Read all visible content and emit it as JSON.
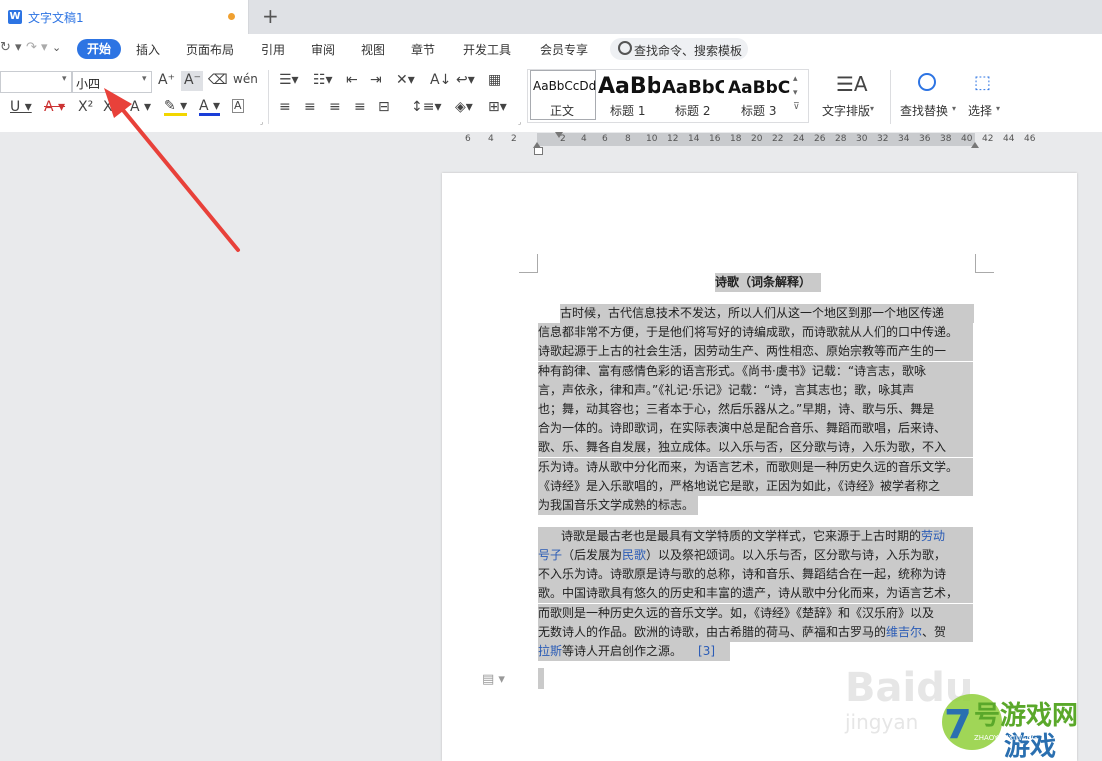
{
  "tab": {
    "title": "文字文稿1",
    "new_tab": "+"
  },
  "menu": {
    "items": [
      "开始",
      "插入",
      "页面布局",
      "引用",
      "审阅",
      "视图",
      "章节",
      "开发工具",
      "会员专享"
    ],
    "search_placeholder": "查找命令、搜索模板"
  },
  "ribbon": {
    "font_size": "小四",
    "styles": [
      {
        "sample": "AaBbCcDd",
        "label": "正文"
      },
      {
        "sample": "AaBb",
        "label": "标题 1"
      },
      {
        "sample": "AaBbC",
        "label": "标题 2"
      },
      {
        "sample": "AaBbC",
        "label": "标题 3"
      }
    ],
    "text_layout": "文字排版",
    "find_replace": "查找替换",
    "select": "选择"
  },
  "ruler": {
    "numbers": [
      "6",
      "4",
      "2",
      "2",
      "4",
      "6",
      "8",
      "10",
      "12",
      "14",
      "16",
      "18",
      "20",
      "22",
      "24",
      "26",
      "28",
      "30",
      "32",
      "34",
      "36",
      "38",
      "40",
      "42",
      "44",
      "46"
    ]
  },
  "document": {
    "title": "诗歌（词条解释）",
    "para1": [
      "古时候，古代信息技术不发达，所以人们从这一个地区到那一个地区传递",
      "信息都非常不方便，于是他们将写好的诗编成歌，而诗歌就从人们的口中传递。",
      "诗歌起源于上古的社会生活，因劳动生产、两性相恋、原始宗教等而产生的一",
      "种有韵律、富有感情色彩的语言形式。《尚书·虞书》记载：“诗言志，歌咏",
      "言，声依永，律和声。”《礼记·乐记》记载：“诗，言其志也；歌，咏其声",
      "也；舞，动其容也；三者本于心，然后乐器从之。”早期，诗、歌与乐、舞是",
      "合为一体的。诗即歌词，在实际表演中总是配合音乐、舞蹈而歌唱，后来诗、",
      "歌、乐、舞各自发展，独立成体。以入乐与否，区分歌与诗，入乐为歌，不入",
      "乐为诗。诗从歌中分化而来，为语言艺术，而歌则是一种历史久远的音乐文学。",
      "《诗经》是入乐歌唱的，严格地说它是歌，正因为如此，《诗经》被学者称之",
      "为我国音乐文学成熟的标志。"
    ],
    "para2_l1a": "诗歌是最古老也是最具有文学特质的文学样式，它来源于上古时期的",
    "para2_l1b": "劳动",
    "para2_l2a": "号子",
    "para2_l2b": "（后发展为",
    "para2_l2c": "民歌",
    "para2_l2d": "）以及祭祀颂词。以入乐与否，区分歌与诗，入乐为歌，",
    "para2_rest": [
      "不入乐为诗。诗歌原是诗与歌的总称，诗和音乐、舞蹈结合在一起，统称为诗",
      "歌。中国诗歌具有悠久的历史和丰富的遗产，诗从歌中分化而来，为语言艺术，",
      "而歌则是一种历史久远的音乐文学。如，《诗经》《楚辞》和《汉乐府》以及"
    ],
    "para2_l6a": "无数诗人的作品。欧洲的诗歌，由古希腊的荷马、萨福和古罗马的",
    "para2_l6b": "维吉尔",
    "para2_l6c": "、贺",
    "para2_l7a": "拉斯",
    "para2_l7b": "等诗人开启创作之源。",
    "ref": "[3]"
  },
  "watermark": {
    "baidu": "Baidu",
    "jingyan": "jingyan",
    "site": "7号游戏网",
    "site_sub": "ZHAOYOUXIWANG"
  },
  "colors": {
    "accent": "#2d74e3",
    "selection": "#cacaca",
    "arrow": "#e8413a",
    "link": "#2b5cb6"
  }
}
